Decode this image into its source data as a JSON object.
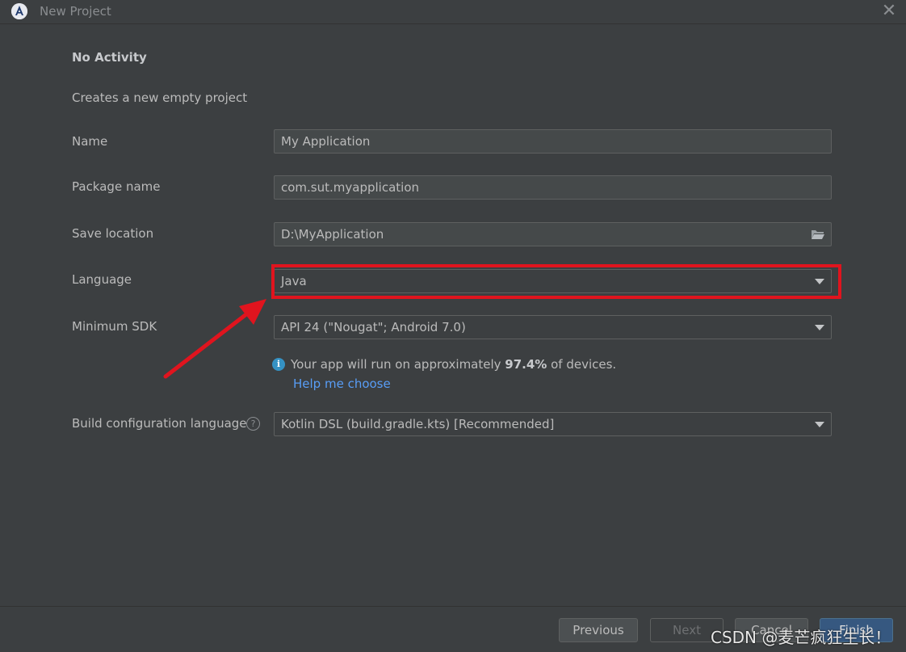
{
  "window": {
    "title": "New Project",
    "close_glyph": "✕",
    "icon": "android-studio-icon"
  },
  "form": {
    "section_title": "No Activity",
    "section_description": "Creates a new empty project",
    "name_label": "Name",
    "name_value": "My Application",
    "package_label": "Package name",
    "package_value": "com.sut.myapplication",
    "save_location_label": "Save location",
    "save_location_value": "D:\\MyApplication",
    "language_label": "Language",
    "language_value": "Java",
    "min_sdk_label": "Minimum SDK",
    "min_sdk_value": "API 24 (\"Nougat\"; Android 7.0)",
    "info_prefix": "Your app will run on approximately ",
    "info_percent": "97.4%",
    "info_suffix": " of devices.",
    "help_link": "Help me choose",
    "build_config_label": "Build configuration language",
    "build_config_value": "Kotlin DSL (build.gradle.kts) [Recommended]"
  },
  "footer": {
    "previous": "Previous",
    "next": "Next",
    "cancel": "Cancel",
    "finish": "Finish"
  },
  "watermark": "CSDN @麦芒疯狂生长！",
  "colors": {
    "background": "#3c3f41",
    "field_bg": "#45494a",
    "link": "#589df6",
    "highlight": "#e0141e",
    "primary_button": "#365880"
  }
}
